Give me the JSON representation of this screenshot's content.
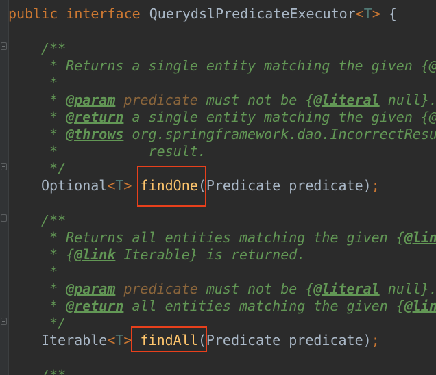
{
  "editor": {
    "lines": {
      "l0": {
        "kw1": "public",
        "kw2": "interface",
        "name": "QuerydslPredicateExecutor",
        "lt": "<",
        "t": "T",
        "gt": ">",
        "brace": " {"
      },
      "l1": {
        "text": "/**"
      },
      "l2": {
        "star": " * ",
        "text": "Returns a single entity matching the given {@"
      },
      "l3": {
        "text": " *"
      },
      "l4": {
        "star": " * ",
        "tag": "@param",
        "param": "predicate",
        "mid": " must not be {",
        "link": "@literal",
        "rest": " null}."
      },
      "l5": {
        "star": " * ",
        "tag": "@return",
        "rest": " a single entity matching the given {@"
      },
      "l6": {
        "star": " * ",
        "tag": "@throws",
        "rest": " org.springframework.dao.IncorrectResu"
      },
      "l7": {
        "text": " *           result."
      },
      "l8": {
        "text": " */"
      },
      "l9": {
        "type": "Optional",
        "lt": "<",
        "t": "T",
        "gt": ">",
        "method": "findOne",
        "args": "(Predicate predicate)",
        "semi": ";"
      },
      "l10": {
        "text": "/**"
      },
      "l11": {
        "star": " * ",
        "text": "Returns all entities matching the given {",
        "link": "@lin"
      },
      "l12": {
        "star": " * {",
        "link": "@link",
        "rest": " Iterable} is returned."
      },
      "l13": {
        "text": " *"
      },
      "l14": {
        "star": " * ",
        "tag": "@param",
        "param": "predicate",
        "mid": " must not be {",
        "link": "@literal",
        "rest": " null}."
      },
      "l15": {
        "star": " * ",
        "tag": "@return",
        "rest": " all entities matching the given {",
        "link": "@lin"
      },
      "l16": {
        "text": " */"
      },
      "l17": {
        "type": "Iterable",
        "lt": "<",
        "t": "T",
        "gt": ">",
        "method": "findAll",
        "args": "(Predicate predicate)",
        "semi": ";"
      },
      "l18": {
        "text": "/**"
      }
    }
  }
}
